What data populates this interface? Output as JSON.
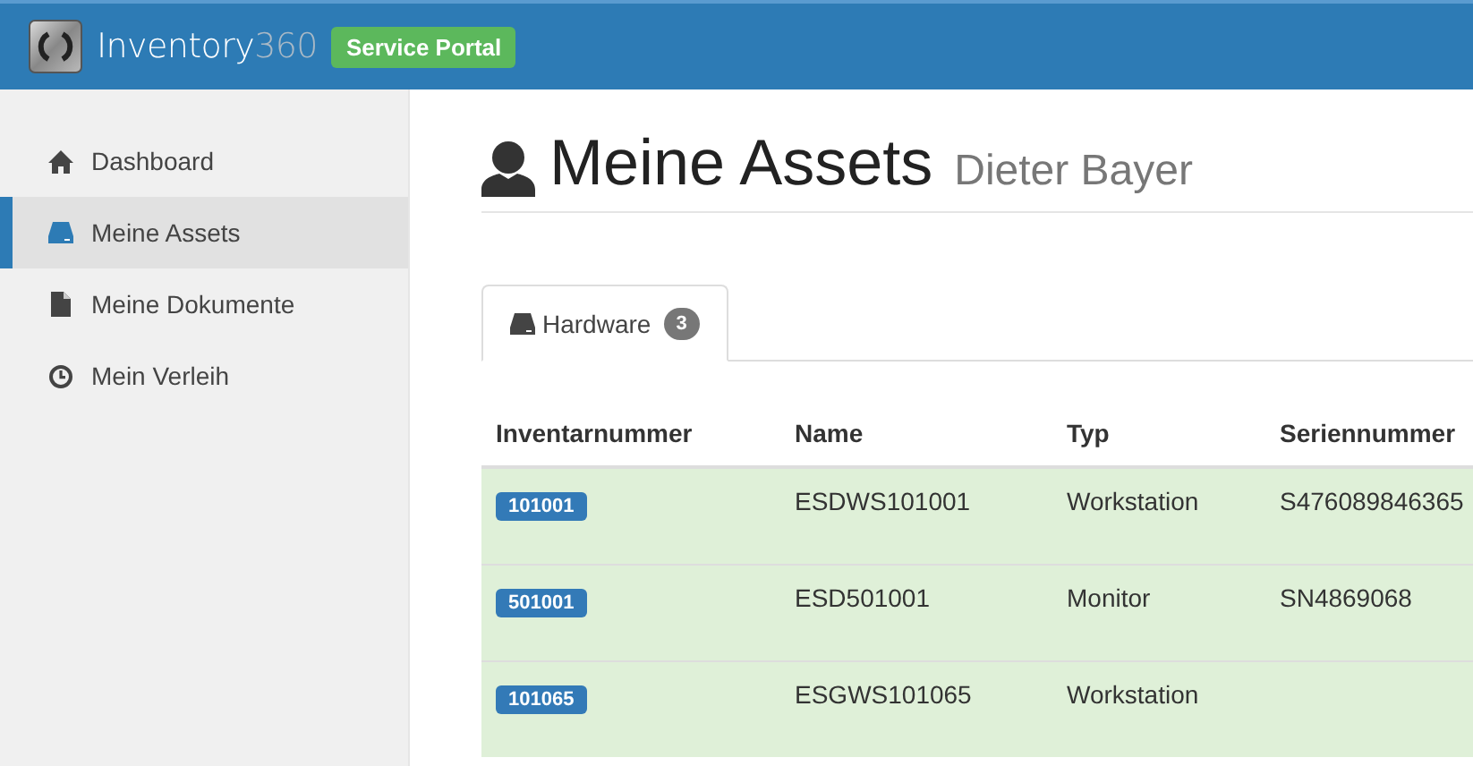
{
  "header": {
    "brand": "Inventory",
    "brand_number": "360",
    "badge": "Service Portal"
  },
  "sidebar": {
    "items": [
      {
        "label": "Dashboard",
        "selected": false
      },
      {
        "label": "Meine Assets",
        "selected": true
      },
      {
        "label": "Meine Dokumente",
        "selected": false
      },
      {
        "label": "Mein Verleih",
        "selected": false
      }
    ]
  },
  "page": {
    "title": "Meine Assets",
    "subtitle": "Dieter Bayer"
  },
  "tabs": [
    {
      "label": "Hardware",
      "count": "3",
      "selected": true
    }
  ],
  "table": {
    "columns": [
      "Inventarnummer",
      "Name",
      "Typ",
      "Seriennummer"
    ],
    "rows": [
      {
        "inventory": "101001",
        "name": "ESDWS101001",
        "type": "Workstation",
        "serial": "S476089846365"
      },
      {
        "inventory": "501001",
        "name": "ESD501001",
        "type": "Monitor",
        "serial": "SN4869068"
      },
      {
        "inventory": "101065",
        "name": "ESGWS101065",
        "type": "Workstation",
        "serial": ""
      }
    ]
  }
}
